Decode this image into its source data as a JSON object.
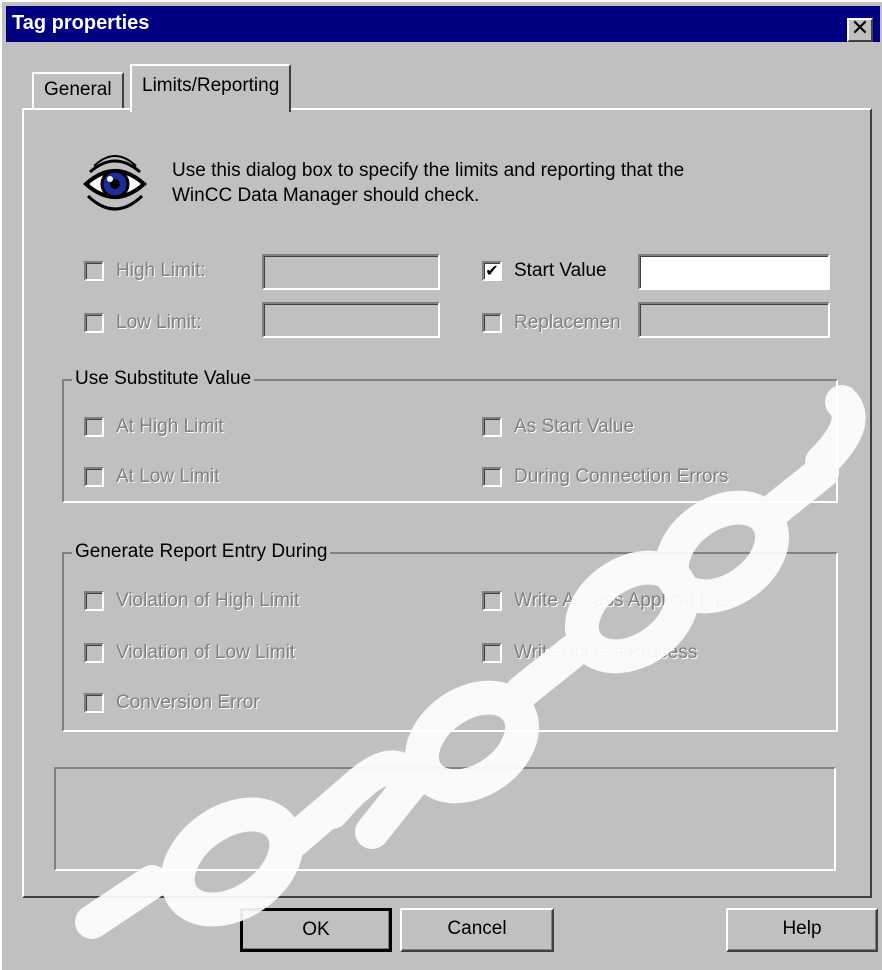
{
  "window": {
    "title": "Tag properties"
  },
  "tabs": [
    {
      "label": "General",
      "active": false
    },
    {
      "label": "Limits/Reporting",
      "active": true
    }
  ],
  "intro_text": {
    "line1": "Use this dialog box to specify the limits and reporting that the",
    "line2": "WinCC Data Manager should check."
  },
  "limits": {
    "high_limit": {
      "label": "High Limit:",
      "checked": false,
      "enabled": false,
      "value": ""
    },
    "low_limit": {
      "label": "Low Limit:",
      "checked": false,
      "enabled": false,
      "value": ""
    },
    "start_value": {
      "label": "Start Value",
      "checked": true,
      "enabled": true,
      "value": ""
    },
    "replacement": {
      "label": "Replacemen",
      "checked": false,
      "enabled": false,
      "value": ""
    }
  },
  "substitute_group": {
    "title": "Use Substitute Value",
    "items": {
      "at_high_limit": "At High Limit",
      "as_start_value": "As Start Value",
      "at_low_limit": "At Low Limit",
      "during_connection_errors": "During Connection Errors"
    }
  },
  "report_group": {
    "title": "Generate Report Entry During",
    "items": {
      "violation_high": "Violation of High Limit",
      "write_access_applications": "Write Access Applications",
      "violation_low": "Violation of Low Limit",
      "write_access_process": "Write Access Process",
      "conversion_error": "Conversion Error"
    }
  },
  "buttons": {
    "ok": "OK",
    "cancel": "Cancel",
    "help": "Help"
  },
  "close_glyph": "✕",
  "check_glyph": "✔",
  "colors": {
    "titlebar": "#000080",
    "face": "#c0c0c0",
    "disabled_text": "#808080"
  }
}
